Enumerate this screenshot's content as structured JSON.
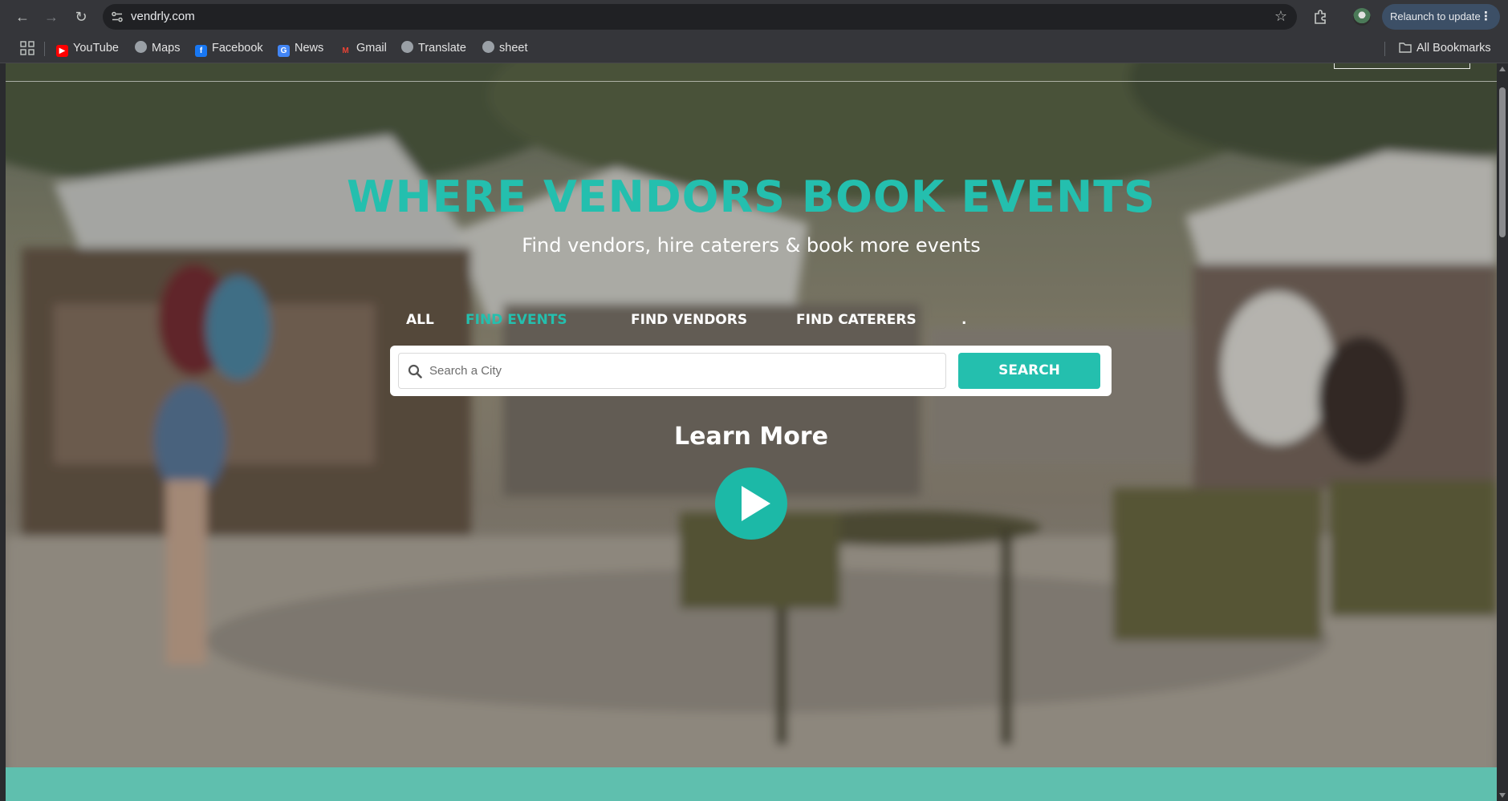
{
  "browser": {
    "url": "vendrly.com",
    "relaunch_label": "Relaunch to update",
    "bookmarks": [
      {
        "label": "YouTube",
        "icon": "youtube-icon",
        "color": "#ff0000"
      },
      {
        "label": "Maps",
        "icon": "globe-icon",
        "color": "#9aa0a6"
      },
      {
        "label": "Facebook",
        "icon": "facebook-icon",
        "color": "#1877f2"
      },
      {
        "label": "News",
        "icon": "news-icon",
        "color": "#4285f4"
      },
      {
        "label": "Gmail",
        "icon": "gmail-icon",
        "color": "#ea4335"
      },
      {
        "label": "Translate",
        "icon": "globe-icon",
        "color": "#9aa0a6"
      },
      {
        "label": "sheet",
        "icon": "globe-icon",
        "color": "#9aa0a6"
      }
    ],
    "all_bookmarks_label": "All Bookmarks"
  },
  "hero": {
    "headline": "WHERE VENDORS BOOK EVENTS",
    "subheadline": "Find vendors, hire caterers & book more events",
    "tabs": [
      {
        "label": "ALL",
        "active": false
      },
      {
        "label": "FIND EVENTS",
        "active": true
      },
      {
        "label": "FIND VENDORS",
        "active": false
      },
      {
        "label": "FIND CATERERS",
        "active": false
      },
      {
        "label": ".",
        "active": false
      }
    ],
    "search": {
      "placeholder": "Search a City",
      "button_label": "SEARCH"
    },
    "learn_more": "Learn More"
  },
  "colors": {
    "accent": "#24bfae",
    "band": "#5fbfae"
  }
}
